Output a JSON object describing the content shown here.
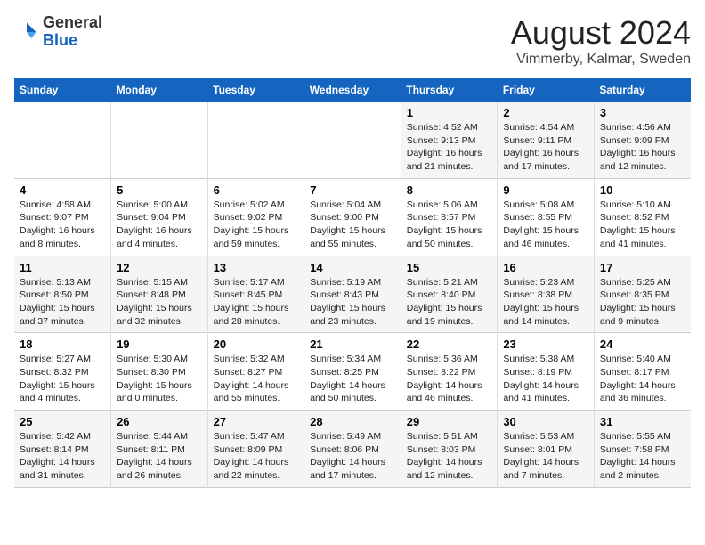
{
  "logo": {
    "general": "General",
    "blue": "Blue"
  },
  "title": "August 2024",
  "subtitle": "Vimmerby, Kalmar, Sweden",
  "weekdays": [
    "Sunday",
    "Monday",
    "Tuesday",
    "Wednesday",
    "Thursday",
    "Friday",
    "Saturday"
  ],
  "weeks": [
    [
      {
        "day": "",
        "info": ""
      },
      {
        "day": "",
        "info": ""
      },
      {
        "day": "",
        "info": ""
      },
      {
        "day": "",
        "info": ""
      },
      {
        "day": "1",
        "info": "Sunrise: 4:52 AM\nSunset: 9:13 PM\nDaylight: 16 hours and 21 minutes."
      },
      {
        "day": "2",
        "info": "Sunrise: 4:54 AM\nSunset: 9:11 PM\nDaylight: 16 hours and 17 minutes."
      },
      {
        "day": "3",
        "info": "Sunrise: 4:56 AM\nSunset: 9:09 PM\nDaylight: 16 hours and 12 minutes."
      }
    ],
    [
      {
        "day": "4",
        "info": "Sunrise: 4:58 AM\nSunset: 9:07 PM\nDaylight: 16 hours and 8 minutes."
      },
      {
        "day": "5",
        "info": "Sunrise: 5:00 AM\nSunset: 9:04 PM\nDaylight: 16 hours and 4 minutes."
      },
      {
        "day": "6",
        "info": "Sunrise: 5:02 AM\nSunset: 9:02 PM\nDaylight: 15 hours and 59 minutes."
      },
      {
        "day": "7",
        "info": "Sunrise: 5:04 AM\nSunset: 9:00 PM\nDaylight: 15 hours and 55 minutes."
      },
      {
        "day": "8",
        "info": "Sunrise: 5:06 AM\nSunset: 8:57 PM\nDaylight: 15 hours and 50 minutes."
      },
      {
        "day": "9",
        "info": "Sunrise: 5:08 AM\nSunset: 8:55 PM\nDaylight: 15 hours and 46 minutes."
      },
      {
        "day": "10",
        "info": "Sunrise: 5:10 AM\nSunset: 8:52 PM\nDaylight: 15 hours and 41 minutes."
      }
    ],
    [
      {
        "day": "11",
        "info": "Sunrise: 5:13 AM\nSunset: 8:50 PM\nDaylight: 15 hours and 37 minutes."
      },
      {
        "day": "12",
        "info": "Sunrise: 5:15 AM\nSunset: 8:48 PM\nDaylight: 15 hours and 32 minutes."
      },
      {
        "day": "13",
        "info": "Sunrise: 5:17 AM\nSunset: 8:45 PM\nDaylight: 15 hours and 28 minutes."
      },
      {
        "day": "14",
        "info": "Sunrise: 5:19 AM\nSunset: 8:43 PM\nDaylight: 15 hours and 23 minutes."
      },
      {
        "day": "15",
        "info": "Sunrise: 5:21 AM\nSunset: 8:40 PM\nDaylight: 15 hours and 19 minutes."
      },
      {
        "day": "16",
        "info": "Sunrise: 5:23 AM\nSunset: 8:38 PM\nDaylight: 15 hours and 14 minutes."
      },
      {
        "day": "17",
        "info": "Sunrise: 5:25 AM\nSunset: 8:35 PM\nDaylight: 15 hours and 9 minutes."
      }
    ],
    [
      {
        "day": "18",
        "info": "Sunrise: 5:27 AM\nSunset: 8:32 PM\nDaylight: 15 hours and 4 minutes."
      },
      {
        "day": "19",
        "info": "Sunrise: 5:30 AM\nSunset: 8:30 PM\nDaylight: 15 hours and 0 minutes."
      },
      {
        "day": "20",
        "info": "Sunrise: 5:32 AM\nSunset: 8:27 PM\nDaylight: 14 hours and 55 minutes."
      },
      {
        "day": "21",
        "info": "Sunrise: 5:34 AM\nSunset: 8:25 PM\nDaylight: 14 hours and 50 minutes."
      },
      {
        "day": "22",
        "info": "Sunrise: 5:36 AM\nSunset: 8:22 PM\nDaylight: 14 hours and 46 minutes."
      },
      {
        "day": "23",
        "info": "Sunrise: 5:38 AM\nSunset: 8:19 PM\nDaylight: 14 hours and 41 minutes."
      },
      {
        "day": "24",
        "info": "Sunrise: 5:40 AM\nSunset: 8:17 PM\nDaylight: 14 hours and 36 minutes."
      }
    ],
    [
      {
        "day": "25",
        "info": "Sunrise: 5:42 AM\nSunset: 8:14 PM\nDaylight: 14 hours and 31 minutes."
      },
      {
        "day": "26",
        "info": "Sunrise: 5:44 AM\nSunset: 8:11 PM\nDaylight: 14 hours and 26 minutes."
      },
      {
        "day": "27",
        "info": "Sunrise: 5:47 AM\nSunset: 8:09 PM\nDaylight: 14 hours and 22 minutes."
      },
      {
        "day": "28",
        "info": "Sunrise: 5:49 AM\nSunset: 8:06 PM\nDaylight: 14 hours and 17 minutes."
      },
      {
        "day": "29",
        "info": "Sunrise: 5:51 AM\nSunset: 8:03 PM\nDaylight: 14 hours and 12 minutes."
      },
      {
        "day": "30",
        "info": "Sunrise: 5:53 AM\nSunset: 8:01 PM\nDaylight: 14 hours and 7 minutes."
      },
      {
        "day": "31",
        "info": "Sunrise: 5:55 AM\nSunset: 7:58 PM\nDaylight: 14 hours and 2 minutes."
      }
    ]
  ]
}
